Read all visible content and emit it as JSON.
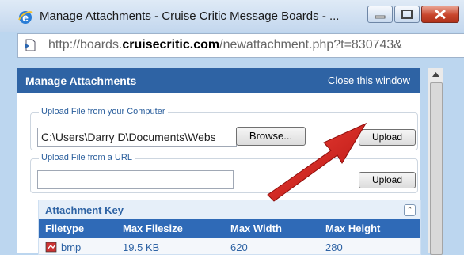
{
  "window": {
    "title": "Manage Attachments - Cruise Critic Message Boards - ...",
    "buttons": {
      "minimize": "minimize",
      "maximize": "maximize",
      "close": "close"
    }
  },
  "address_bar": {
    "prefix": "http://boards.",
    "domain": "cruisecritic.com",
    "suffix": "/newattachment.php?t=830743&"
  },
  "panel": {
    "title": "Manage Attachments",
    "close_link": "Close this window",
    "upload_file": {
      "legend": "Upload File from your Computer",
      "path": "C:\\Users\\Darry D\\Documents\\Webs",
      "browse_label": "Browse...",
      "upload_label": "Upload"
    },
    "upload_url": {
      "legend": "Upload File from a URL",
      "value": "",
      "upload_label": "Upload"
    },
    "attachment_key": {
      "title": "Attachment Key",
      "columns": [
        "Filetype",
        "Max Filesize",
        "Max Width",
        "Max Height"
      ],
      "row": {
        "filetype": "bmp",
        "max_filesize": "19.5 KB",
        "max_width": "620",
        "max_height": "280"
      }
    }
  },
  "colors": {
    "panel_header": "#2e63a4",
    "column_header": "#2f6ab7",
    "arrow": "#d8231f"
  },
  "icons": {
    "browser": "internet-explorer-icon",
    "page": "page-icon",
    "collapse": "collapse-icon",
    "file_type": "bmp-file-icon"
  }
}
